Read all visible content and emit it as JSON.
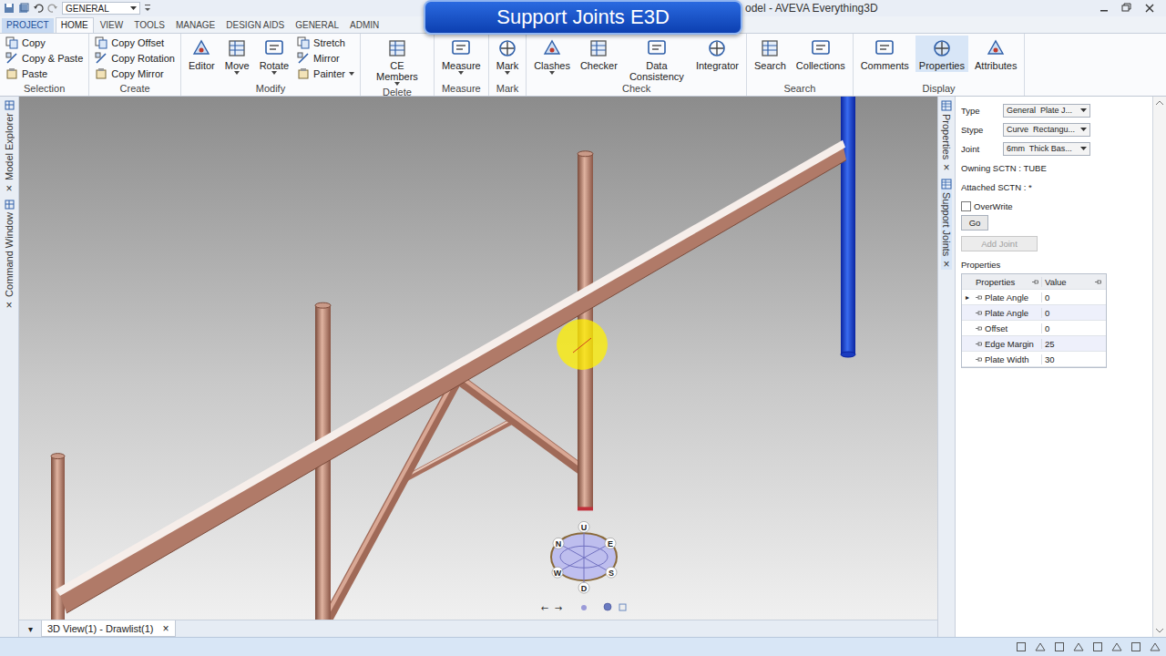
{
  "title_bar": {
    "workspace": "GENERAL",
    "title": "odel - AVEVA Everything3D"
  },
  "banner": "Support Joints E3D",
  "tabs": [
    {
      "label": "PROJECT",
      "kind": "file",
      "selected": false
    },
    {
      "label": "HOME",
      "kind": "tab",
      "selected": true
    },
    {
      "label": "VIEW",
      "kind": "tab",
      "selected": false
    },
    {
      "label": "TOOLS",
      "kind": "tab",
      "selected": false
    },
    {
      "label": "MANAGE",
      "kind": "tab",
      "selected": false
    },
    {
      "label": "DESIGN AIDS",
      "kind": "tab",
      "selected": false
    },
    {
      "label": "GENERAL",
      "kind": "tab",
      "selected": false
    },
    {
      "label": "ADMIN",
      "kind": "tab",
      "selected": false
    }
  ],
  "ribbon": [
    {
      "name": "Selection",
      "items": [
        {
          "label": "Copy",
          "kind": "small",
          "dropdown": false,
          "selected": false
        },
        {
          "label": "Copy & Paste",
          "kind": "small",
          "dropdown": false,
          "selected": false
        },
        {
          "label": "Paste",
          "kind": "small",
          "dropdown": false,
          "selected": false
        }
      ]
    },
    {
      "name": "Create",
      "items": [
        {
          "label": "Copy Offset",
          "kind": "small",
          "dropdown": false,
          "selected": false
        },
        {
          "label": "Copy Rotation",
          "kind": "small",
          "dropdown": false,
          "selected": false
        },
        {
          "label": "Copy Mirror",
          "kind": "small",
          "dropdown": false,
          "selected": false
        }
      ]
    },
    {
      "name": "Modify",
      "items": [
        {
          "label": "Editor",
          "kind": "large",
          "dropdown": false,
          "selected": false
        },
        {
          "label": "Move",
          "kind": "large",
          "dropdown": true,
          "selected": false
        },
        {
          "label": "Rotate",
          "kind": "large",
          "dropdown": true,
          "selected": false
        },
        {
          "label": "Stretch",
          "kind": "small",
          "dropdown": false,
          "selected": false
        },
        {
          "label": "Mirror",
          "kind": "small",
          "dropdown": false,
          "selected": false
        },
        {
          "label": "Painter",
          "kind": "small",
          "dropdown": true,
          "selected": false
        }
      ]
    },
    {
      "name": "Delete",
      "items": [
        {
          "label": "CE Members",
          "kind": "large",
          "dropdown": true,
          "selected": false
        }
      ]
    },
    {
      "name": "Measure",
      "items": [
        {
          "label": "Measure",
          "kind": "large",
          "dropdown": true,
          "selected": false
        }
      ]
    },
    {
      "name": "Mark",
      "items": [
        {
          "label": "Mark",
          "kind": "large",
          "dropdown": true,
          "selected": false
        }
      ]
    },
    {
      "name": "Check",
      "items": [
        {
          "label": "Clashes",
          "kind": "large",
          "dropdown": true,
          "selected": false
        },
        {
          "label": "Checker",
          "kind": "large",
          "dropdown": false,
          "selected": false
        },
        {
          "label": "Data Consistency",
          "kind": "large",
          "dropdown": false,
          "selected": false
        },
        {
          "label": "Integrator",
          "kind": "large",
          "dropdown": false,
          "selected": false
        }
      ]
    },
    {
      "name": "Search",
      "items": [
        {
          "label": "Search",
          "kind": "large",
          "dropdown": false,
          "selected": false
        },
        {
          "label": "Collections",
          "kind": "large",
          "dropdown": false,
          "selected": false
        }
      ]
    },
    {
      "name": "Display",
      "items": [
        {
          "label": "Comments",
          "kind": "large",
          "dropdown": false,
          "selected": false
        },
        {
          "label": "Properties",
          "kind": "large",
          "dropdown": false,
          "selected": true
        },
        {
          "label": "Attributes",
          "kind": "large",
          "dropdown": false,
          "selected": false
        }
      ]
    }
  ],
  "left_dock": [
    {
      "label": "Model Explorer",
      "close": "×"
    },
    {
      "label": "Command Window",
      "close": "×"
    }
  ],
  "viewport": {
    "compass": [
      "U",
      "N",
      "E",
      "W",
      "S",
      "D"
    ],
    "nav": [
      "←",
      "→"
    ]
  },
  "right_dock": [
    {
      "label": "Properties",
      "selected": false,
      "close": "×"
    },
    {
      "label": "Support Joints",
      "selected": true,
      "close": "×"
    }
  ],
  "support_joints": {
    "fields": [
      {
        "label": "Type",
        "value": "General  Plate J..."
      },
      {
        "label": "Stype",
        "value": "Curve  Rectangu..."
      },
      {
        "label": "Joint",
        "value": "6mm  Thick Bas..."
      }
    ],
    "owning": "Owning SCTN : TUBE",
    "attached": "Attached SCTN : *",
    "overwrite": {
      "label": "OverWrite",
      "checked": false
    },
    "go": "Go",
    "add_joint": {
      "label": "Add Joint",
      "disabled": true
    },
    "properties_title": "Properties",
    "grid": {
      "columns": [
        "Properties",
        "Value"
      ],
      "marker": "▸",
      "rows": [
        {
          "name": "Plate Angle",
          "value": "0",
          "current": true
        },
        {
          "name": "Plate Angle",
          "value": "0",
          "current": false
        },
        {
          "name": "Offset",
          "value": "0",
          "current": false
        },
        {
          "name": "Edge Margin",
          "value": "25",
          "current": false
        },
        {
          "name": "Plate Width",
          "value": "30",
          "current": false
        }
      ]
    }
  },
  "doc_tabs": {
    "menu": "▾",
    "tabs": [
      {
        "label": "3D View(1) - Drawlist(1)",
        "selected": true,
        "close": "×"
      }
    ]
  }
}
